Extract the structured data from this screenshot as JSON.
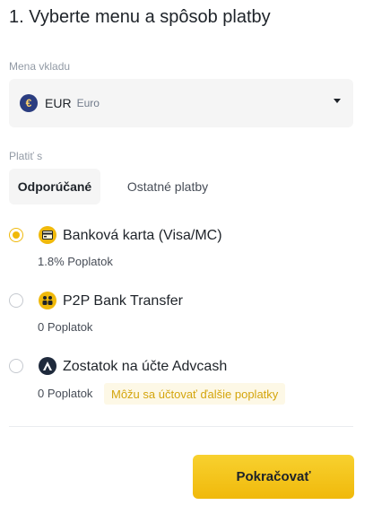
{
  "title": "1. Vyberte menu a spôsob platby",
  "currency": {
    "label": "Mena vkladu",
    "code": "EUR",
    "name": "Euro",
    "icon": "euro-icon",
    "symbol": "€"
  },
  "payment": {
    "label": "Platiť s",
    "tabs": [
      {
        "label": "Odporúčané",
        "active": true
      },
      {
        "label": "Ostatné platby",
        "active": false
      }
    ],
    "options": [
      {
        "title": "Banková karta (Visa/MC)",
        "fee": "1.8% Poplatok",
        "selected": true,
        "icon": "bank-card-icon"
      },
      {
        "title": "P2P Bank Transfer",
        "fee": "0 Poplatok",
        "selected": false,
        "icon": "p2p-transfer-icon"
      },
      {
        "title": "Zostatok na účte Advcash",
        "fee": "0 Poplatok",
        "selected": false,
        "icon": "advcash-icon",
        "note": "Môžu sa účtovať ďalšie poplatky"
      }
    ]
  },
  "continue_label": "Pokračovať",
  "colors": {
    "accent": "#f0b90b",
    "note_bg": "#fdf8e6",
    "note_text": "#d4a50d"
  }
}
